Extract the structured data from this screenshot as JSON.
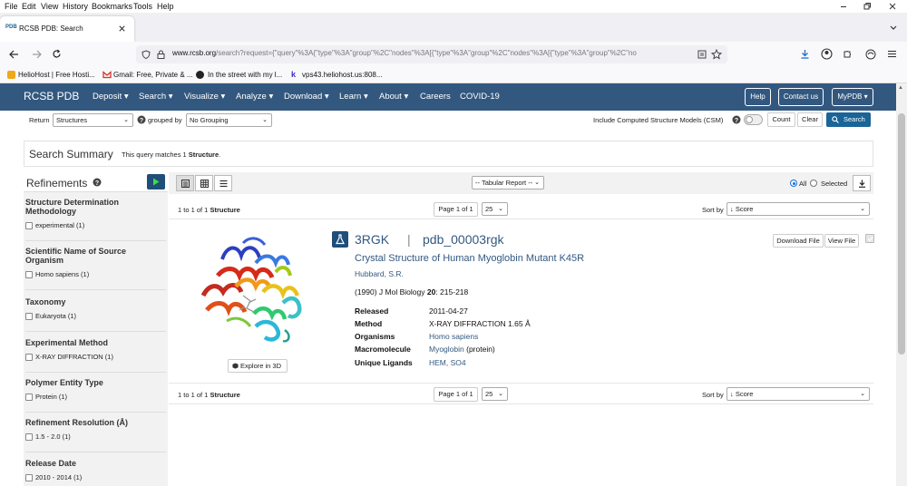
{
  "browser": {
    "menu": [
      "File",
      "Edit",
      "View",
      "History",
      "Bookmarks",
      "Tools",
      "Help"
    ],
    "tab_title": "RCSB PDB: Search",
    "url_domain": "www.rcsb.org",
    "url_path": "/search?request={\"query\"%3A{\"type\"%3A\"group\"%2C\"nodes\"%3A[{\"type\"%3A\"group\"%2C\"nodes\"%3A[{\"type\"%3A\"group\"%2C\"no",
    "bookmarks": [
      "HelioHost | Free Hosti...",
      "Gmail: Free, Private & ...",
      "In the street with my l...",
      "vps43.heliohost.us:808..."
    ]
  },
  "nav": {
    "logo": "RCSB PDB",
    "items": [
      "Deposit",
      "Search",
      "Visualize",
      "Analyze",
      "Download",
      "Learn",
      "About",
      "Careers",
      "COVID-19"
    ],
    "help": "Help",
    "contact": "Contact us",
    "mypdb": "MyPDB"
  },
  "search_bar": {
    "return_label": "Return",
    "return_value": "Structures",
    "grouped_label": "grouped by",
    "grouped_value": "No Grouping",
    "csm_label": "Include Computed Structure Models (CSM)",
    "count": "Count",
    "clear": "Clear",
    "search": "Search"
  },
  "summary": {
    "title": "Search Summary",
    "text_pre": "This query matches 1",
    "text_bold": "Structure"
  },
  "refinements": {
    "title": "Refinements",
    "sections": [
      {
        "title": "Structure Determination Methodology",
        "item": "experimental (1)"
      },
      {
        "title": "Scientific Name of Source Organism",
        "item": "Homo sapiens (1)"
      },
      {
        "title": "Taxonomy",
        "item": "Eukaryota (1)"
      },
      {
        "title": "Experimental Method",
        "item": "X-RAY DIFFRACTION (1)"
      },
      {
        "title": "Polymer Entity Type",
        "item": "Protein (1)"
      },
      {
        "title": "Refinement Resolution (Å)",
        "item": "1.5 - 2.0 (1)"
      },
      {
        "title": "Release Date",
        "item": "2010 - 2014 (1)"
      }
    ]
  },
  "results": {
    "report": "-- Tabular Report --",
    "all": "All",
    "selected": "Selected",
    "range_pre": "1 to 1 of 1",
    "range_bold": "Structure",
    "page": "Page 1 of 1",
    "per_page": "25",
    "sort_label": "Sort by",
    "sort_value": "↓ Score",
    "download_file": "Download File",
    "view_file": "View File",
    "explore": "Explore in 3D"
  },
  "entry": {
    "id": "3RGK",
    "pdb_id": "pdb_00003rgk",
    "title": "Crystal Structure of Human Myoglobin Mutant K45R",
    "authors": "Hubbard, S.R.",
    "citation_pre": "(1990) J Mol Biology",
    "citation_vol": "20",
    "citation_pages": ": 215-218",
    "fields": [
      {
        "label": "Released",
        "value": "2011-04-27"
      },
      {
        "label": "Method",
        "value": "X-RAY DIFFRACTION 1.65 Å"
      },
      {
        "label": "Organisms",
        "value": "Homo sapiens"
      },
      {
        "label": "Macromolecule",
        "value": "Myoglobin",
        "suffix": " (protein)"
      },
      {
        "label": "Unique Ligands",
        "value": "HEM, SO4"
      }
    ]
  },
  "colors": {
    "nav": "#325880",
    "link": "#325880",
    "accent": "#1a6496",
    "play": "#1f4e79"
  }
}
